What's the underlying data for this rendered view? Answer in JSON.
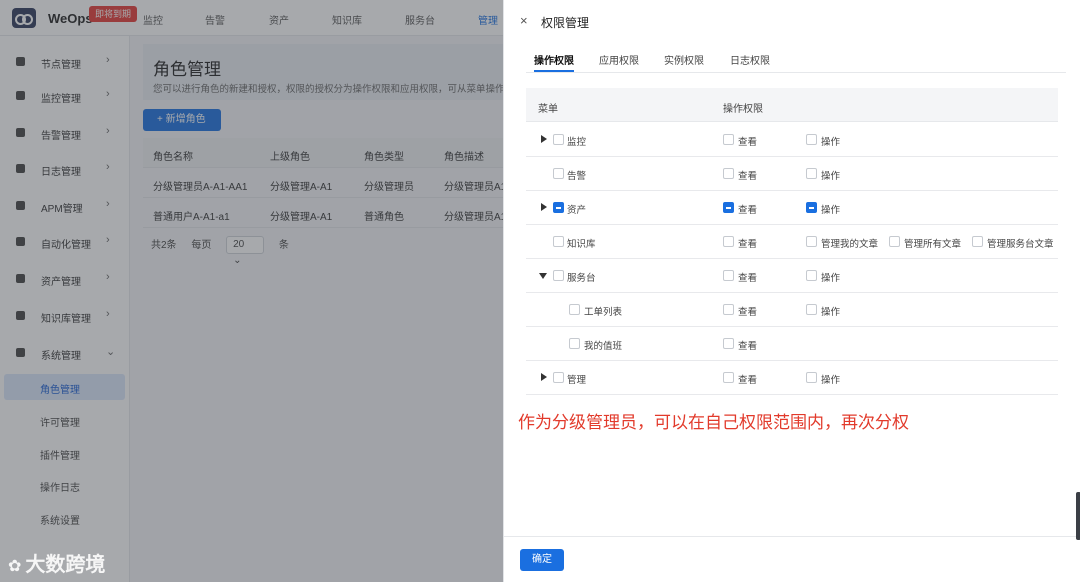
{
  "app": {
    "brand": "WeOps",
    "badge": "即将到期",
    "topnav": [
      "监控",
      "告警",
      "资产",
      "知识库",
      "服务台",
      "管理"
    ]
  },
  "sidebar": {
    "items": [
      {
        "label": "节点管理",
        "icon": "node-icon"
      },
      {
        "label": "监控管理",
        "icon": "monitor-icon"
      },
      {
        "label": "告警管理",
        "icon": "alarm-icon"
      },
      {
        "label": "日志管理",
        "icon": "log-icon"
      },
      {
        "label": "APM管理",
        "icon": "apm-icon"
      },
      {
        "label": "自动化管理",
        "icon": "automation-icon"
      },
      {
        "label": "资产管理",
        "icon": "asset-icon"
      },
      {
        "label": "知识库管理",
        "icon": "knowledge-icon"
      },
      {
        "label": "系统管理",
        "icon": "system-icon"
      }
    ],
    "sub_items": [
      "角色管理",
      "许可管理",
      "插件管理",
      "操作日志",
      "系统设置"
    ],
    "active_sub": "角色管理"
  },
  "page": {
    "title": "角色管理",
    "description": "您可以进行角色的新建和授权，权限的授权分为操作权限和应用权限，可从菜单操作",
    "add_button": "+ 新增角色",
    "table": {
      "headers": [
        "角色名称",
        "上级角色",
        "角色类型",
        "角色描述"
      ],
      "rows": [
        [
          "分级管理员A-A1-AA1",
          "分级管理A-A1",
          "分级管理员",
          "分级管理员A1"
        ],
        [
          "普通用户A-A1-a1",
          "分级管理A-A1",
          "普通角色",
          "分级管理员A1"
        ]
      ]
    },
    "pager": {
      "total": "共2条",
      "per_page_label": "每页",
      "per_page": "20",
      "unit": "条"
    }
  },
  "watermark": {
    "text": "大数跨境"
  },
  "drawer": {
    "close": "×",
    "title": "权限管理",
    "tabs": [
      "操作权限",
      "应用权限",
      "实例权限",
      "日志权限"
    ],
    "active_tab": "操作权限",
    "columns": {
      "menu": "菜单",
      "ops": "操作权限"
    },
    "rows": [
      {
        "name": "监控",
        "caret": "right",
        "view": "查看",
        "view_checked": false,
        "ops": [
          {
            "label": "操作",
            "checked": false
          }
        ]
      },
      {
        "name": "告警",
        "caret": "none",
        "view": "查看",
        "view_checked": false,
        "ops": [
          {
            "label": "操作",
            "checked": false
          }
        ]
      },
      {
        "name": "资产",
        "caret": "right",
        "view": "查看",
        "view_checked": true,
        "partial": true,
        "ops": [
          {
            "label": "操作",
            "checked": true
          }
        ]
      },
      {
        "name": "知识库",
        "caret": "none",
        "view": "查看",
        "view_checked": false,
        "ops": [
          {
            "label": "管理我的文章",
            "checked": false
          },
          {
            "label": "管理所有文章",
            "checked": false
          },
          {
            "label": "管理服务台文章",
            "checked": false
          }
        ]
      },
      {
        "name": "服务台",
        "caret": "down",
        "view": "查看",
        "view_checked": false,
        "ops": [
          {
            "label": "操作",
            "checked": false
          }
        ]
      },
      {
        "name": "工单列表",
        "caret": "child",
        "view": "查看",
        "view_checked": false,
        "ops": [
          {
            "label": "操作",
            "checked": false
          }
        ]
      },
      {
        "name": "我的值班",
        "caret": "child",
        "view": "查看",
        "view_checked": false,
        "ops": []
      },
      {
        "name": "管理",
        "caret": "right",
        "view": "查看",
        "view_checked": false,
        "ops": [
          {
            "label": "操作",
            "checked": false
          }
        ]
      }
    ],
    "annotation": "作为分级管理员，可以在自己权限范围内，再次分权",
    "confirm": "确定"
  }
}
